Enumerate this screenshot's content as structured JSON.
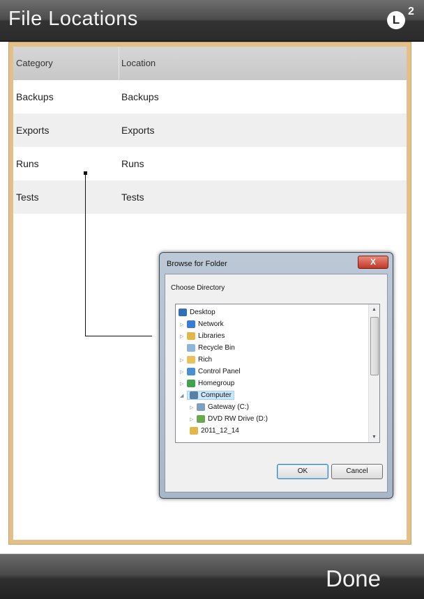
{
  "header": {
    "title": "File Locations",
    "logo_letter": "L",
    "logo_superscript": "2"
  },
  "table": {
    "columns": [
      "Category",
      "Location"
    ],
    "rows": [
      {
        "category": "Backups",
        "location": "Backups"
      },
      {
        "category": "Exports",
        "location": "Exports"
      },
      {
        "category": "Runs",
        "location": "Runs"
      },
      {
        "category": "Tests",
        "location": "Tests"
      }
    ]
  },
  "dialog": {
    "title": "Browse for Folder",
    "close_label": "X",
    "prompt": "Choose Directory",
    "tree": [
      {
        "label": "Desktop",
        "icon": "desktop-icon",
        "color": "#2f6fb3"
      },
      {
        "label": "Network",
        "icon": "network-icon",
        "color": "#3a7bd5"
      },
      {
        "label": "Libraries",
        "icon": "libraries-icon",
        "color": "#e3b64a"
      },
      {
        "label": "Recycle Bin",
        "icon": "recycle-bin-icon",
        "color": "#8fb6d8"
      },
      {
        "label": "Rich",
        "icon": "user-folder-icon",
        "color": "#e8c25a"
      },
      {
        "label": "Control Panel",
        "icon": "control-panel-icon",
        "color": "#4a8fd0"
      },
      {
        "label": "Homegroup",
        "icon": "homegroup-icon",
        "color": "#3fa34d"
      },
      {
        "label": "Computer",
        "icon": "computer-icon",
        "color": "#5a7fa6"
      },
      {
        "label": "Gateway (C:)",
        "icon": "drive-icon",
        "color": "#7f9fbf"
      },
      {
        "label": "DVD RW Drive (D:)",
        "icon": "dvd-drive-icon",
        "color": "#6aa84f"
      },
      {
        "label": "2011_12_14",
        "icon": "folder-icon",
        "color": "#e3b64a"
      }
    ],
    "ok_label": "OK",
    "cancel_label": "Cancel"
  },
  "footer": {
    "done_label": "Done"
  },
  "colors": {
    "frame": "#e2c08a",
    "selection": "#cce8ff"
  }
}
